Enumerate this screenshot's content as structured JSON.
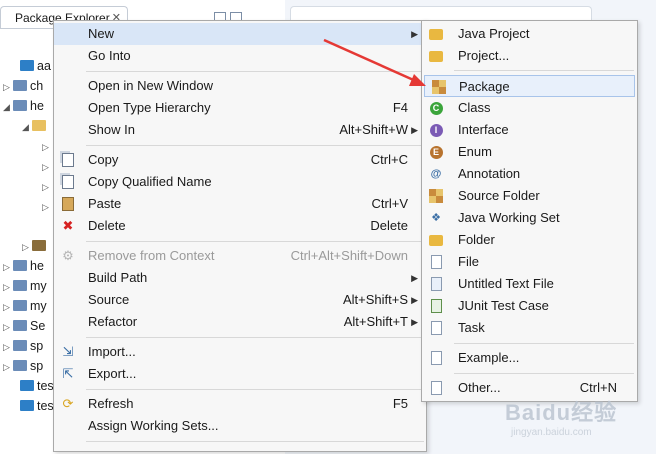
{
  "explorer": {
    "tab_title": "Package Explorer",
    "tree": [
      {
        "label": "aa",
        "kind": "folder"
      },
      {
        "label": "ch",
        "kind": "project"
      },
      {
        "label": "he",
        "kind": "project"
      },
      {
        "label": "",
        "kind": "package"
      },
      {
        "label": "",
        "kind": "child"
      },
      {
        "label": "",
        "kind": "child"
      },
      {
        "label": "",
        "kind": "child"
      },
      {
        "label": "",
        "kind": "child"
      },
      {
        "label": "",
        "kind": "jar"
      },
      {
        "label": "he",
        "kind": "project"
      },
      {
        "label": "my",
        "kind": "project"
      },
      {
        "label": "my",
        "kind": "project"
      },
      {
        "label": "Se",
        "kind": "project"
      },
      {
        "label": "sp",
        "kind": "project"
      },
      {
        "label": "sp",
        "kind": "project"
      },
      {
        "label": "tes",
        "kind": "folder"
      },
      {
        "label": "tes",
        "kind": "folder"
      }
    ]
  },
  "context_menu": {
    "items": [
      {
        "label": "New",
        "shortcut": "",
        "submenu": true,
        "icon": ""
      },
      {
        "label": "Go Into",
        "shortcut": "",
        "icon": ""
      },
      {
        "label": "Open in New Window",
        "shortcut": "",
        "icon": ""
      },
      {
        "label": "Open Type Hierarchy",
        "shortcut": "F4",
        "icon": ""
      },
      {
        "label": "Show In",
        "shortcut": "Alt+Shift+W",
        "submenu": true,
        "icon": ""
      },
      {
        "label": "Copy",
        "shortcut": "Ctrl+C",
        "icon": "copy-icon"
      },
      {
        "label": "Copy Qualified Name",
        "shortcut": "",
        "icon": "copy-qualified-icon"
      },
      {
        "label": "Paste",
        "shortcut": "Ctrl+V",
        "icon": "paste-icon"
      },
      {
        "label": "Delete",
        "shortcut": "Delete",
        "icon": "delete-icon"
      },
      {
        "label": "Remove from Context",
        "shortcut": "Ctrl+Alt+Shift+Down",
        "disabled": true,
        "icon": "remove-context-icon"
      },
      {
        "label": "Build Path",
        "shortcut": "",
        "submenu": true,
        "icon": ""
      },
      {
        "label": "Source",
        "shortcut": "Alt+Shift+S",
        "submenu": true,
        "icon": ""
      },
      {
        "label": "Refactor",
        "shortcut": "Alt+Shift+T",
        "submenu": true,
        "icon": ""
      },
      {
        "label": "Import...",
        "shortcut": "",
        "icon": "import-icon"
      },
      {
        "label": "Export...",
        "shortcut": "",
        "icon": "export-icon"
      },
      {
        "label": "Refresh",
        "shortcut": "F5",
        "icon": "refresh-icon"
      },
      {
        "label": "Assign Working Sets...",
        "shortcut": "",
        "icon": ""
      }
    ]
  },
  "new_submenu": {
    "items": [
      {
        "label": "Java Project",
        "shortcut": "",
        "icon": "java-project-icon"
      },
      {
        "label": "Project...",
        "shortcut": "",
        "icon": "project-icon"
      },
      {
        "label": "Package",
        "shortcut": "",
        "icon": "package-icon",
        "highlighted": true
      },
      {
        "label": "Class",
        "shortcut": "",
        "icon": "class-icon"
      },
      {
        "label": "Interface",
        "shortcut": "",
        "icon": "interface-icon"
      },
      {
        "label": "Enum",
        "shortcut": "",
        "icon": "enum-icon"
      },
      {
        "label": "Annotation",
        "shortcut": "",
        "icon": "annotation-icon"
      },
      {
        "label": "Source Folder",
        "shortcut": "",
        "icon": "source-folder-icon"
      },
      {
        "label": "Java Working Set",
        "shortcut": "",
        "icon": "working-set-icon"
      },
      {
        "label": "Folder",
        "shortcut": "",
        "icon": "folder-icon"
      },
      {
        "label": "File",
        "shortcut": "",
        "icon": "file-icon"
      },
      {
        "label": "Untitled Text File",
        "shortcut": "",
        "icon": "text-file-icon"
      },
      {
        "label": "JUnit Test Case",
        "shortcut": "",
        "icon": "junit-icon"
      },
      {
        "label": "Task",
        "shortcut": "",
        "icon": "task-icon"
      },
      {
        "label": "Example...",
        "shortcut": "",
        "icon": "example-icon"
      },
      {
        "label": "Other...",
        "shortcut": "Ctrl+N",
        "icon": "other-icon"
      }
    ]
  },
  "colors": {
    "class_icon": "#3ba53b",
    "interface_icon": "#7b5bb5",
    "enum_icon": "#b8732e",
    "annotation_arrow": "#e53935",
    "highlight": "#d9e6f7"
  },
  "watermark": {
    "brand": "Baidu经验",
    "url": "jingyan.baidu.com"
  }
}
